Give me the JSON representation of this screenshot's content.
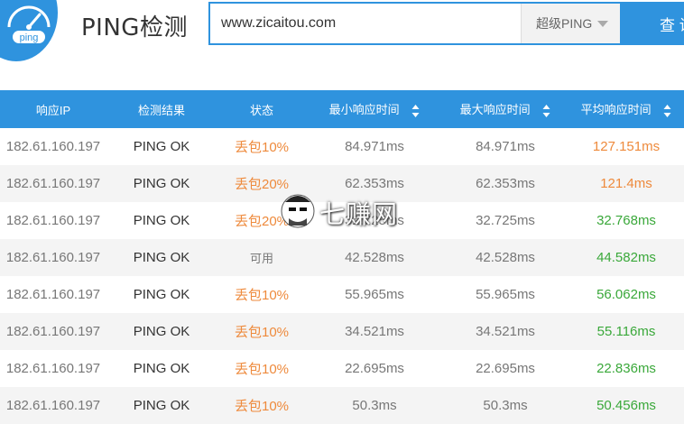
{
  "header": {
    "logo_text": "ping",
    "title": "PING检测",
    "search_value": "www.zicaitou.com",
    "search_placeholder": "",
    "select_value": "超级PING",
    "query_label": "查 询",
    "accent_color": "#2f93de"
  },
  "table": {
    "headers": [
      "响应IP",
      "检测结果",
      "状态",
      "最小响应时间",
      "最大响应时间",
      "平均响应时间"
    ],
    "rows": [
      {
        "ip": "182.61.160.197",
        "result": "PING OK",
        "status": "丢包10%",
        "min": "84.971ms",
        "max": "84.971ms",
        "avg": "127.151ms",
        "avg_color": "orange"
      },
      {
        "ip": "182.61.160.197",
        "result": "PING OK",
        "status": "丢包20%",
        "min": "62.353ms",
        "max": "62.353ms",
        "avg": "121.4ms",
        "avg_color": "orange"
      },
      {
        "ip": "182.61.160.197",
        "result": "PING OK",
        "status": "丢包20%",
        "min": "32.725ms",
        "max": "32.725ms",
        "avg": "32.768ms",
        "avg_color": "green"
      },
      {
        "ip": "182.61.160.197",
        "result": "PING OK",
        "status": "可用",
        "min": "42.528ms",
        "max": "42.528ms",
        "avg": "44.582ms",
        "avg_color": "green"
      },
      {
        "ip": "182.61.160.197",
        "result": "PING OK",
        "status": "丢包10%",
        "min": "55.965ms",
        "max": "55.965ms",
        "avg": "56.062ms",
        "avg_color": "green"
      },
      {
        "ip": "182.61.160.197",
        "result": "PING OK",
        "status": "丢包10%",
        "min": "34.521ms",
        "max": "34.521ms",
        "avg": "55.116ms",
        "avg_color": "green"
      },
      {
        "ip": "182.61.160.197",
        "result": "PING OK",
        "status": "丢包10%",
        "min": "22.695ms",
        "max": "22.695ms",
        "avg": "22.836ms",
        "avg_color": "green"
      },
      {
        "ip": "182.61.160.197",
        "result": "PING OK",
        "status": "丢包10%",
        "min": "50.3ms",
        "max": "50.3ms",
        "avg": "50.456ms",
        "avg_color": "green"
      }
    ]
  },
  "watermark": {
    "text": "七赚网"
  },
  "colors": {
    "loss": "#ee8a3c",
    "good": "#3aa83a",
    "header_bg": "#2f93de",
    "row_alt": "#f4f4f4"
  }
}
